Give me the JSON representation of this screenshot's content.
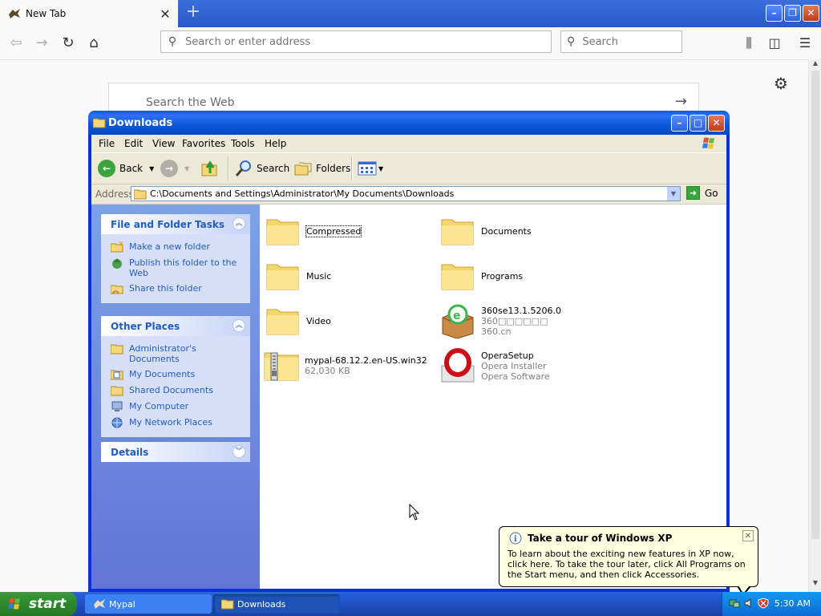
{
  "browser": {
    "tab_title": "New Tab",
    "tab_close": "✕",
    "new_tab": "+",
    "url_placeholder": "Search or enter address",
    "search_placeholder": "Search",
    "page_search_text": "Search the Web",
    "page_search_arrow": "→"
  },
  "explorer": {
    "title": "Downloads",
    "menus": [
      "File",
      "Edit",
      "View",
      "Favorites",
      "Tools",
      "Help"
    ],
    "toolbar": {
      "back": "Back",
      "search": "Search",
      "folders": "Folders"
    },
    "address_label": "Address",
    "address": "C:\\Documents and Settings\\Administrator\\My Documents\\Downloads",
    "go": "Go",
    "tasks": {
      "title": "File and Folder Tasks",
      "items": [
        "Make a new folder",
        "Publish this folder to the Web",
        "Share this folder"
      ]
    },
    "other_places": {
      "title": "Other Places",
      "items": [
        "Administrator's Documents",
        "My Documents",
        "Shared Documents",
        "My Computer",
        "My Network Places"
      ]
    },
    "details": {
      "title": "Details"
    },
    "files": [
      {
        "name": "Compressed",
        "kind": "folder"
      },
      {
        "name": "Documents",
        "kind": "folder"
      },
      {
        "name": "Music",
        "kind": "folder"
      },
      {
        "name": "Programs",
        "kind": "folder"
      },
      {
        "name": "Video",
        "kind": "folder"
      },
      {
        "name": "360se13.1.5206.0",
        "line2": "360□□□□□□",
        "line3": "360.cn",
        "kind": "installer-360"
      },
      {
        "name": "mypal-68.12.2.en-US.win32",
        "line2": "62,030 KB",
        "kind": "zip"
      },
      {
        "name": "OperaSetup",
        "line2": "Opera Installer",
        "line3": "Opera Software",
        "kind": "opera"
      }
    ]
  },
  "balloon": {
    "title": "Take a tour of Windows XP",
    "body": "To learn about the exciting new features in XP now, click here. To take the tour later, click All Programs on the Start menu, and then click Accessories."
  },
  "taskbar": {
    "start": "start",
    "tasks": [
      "Mypal",
      "Downloads"
    ],
    "time": "5:30 AM"
  },
  "colors": {
    "xp_blue": "#0831d9",
    "taskpane_link": "#215dc6",
    "start_green": "#2e8b2e"
  }
}
